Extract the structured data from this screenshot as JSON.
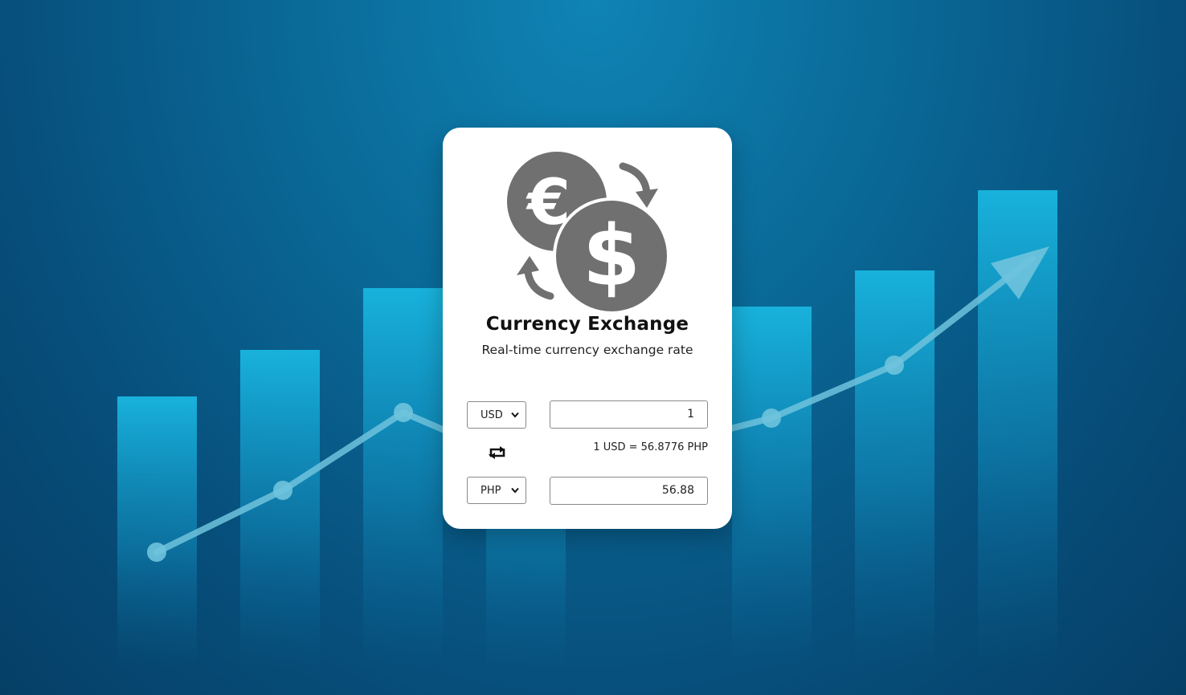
{
  "app": {
    "title": "Currency Exchange",
    "subtitle": "Real-time currency exchange rate"
  },
  "from": {
    "currency": "USD",
    "amount": "1"
  },
  "to": {
    "currency": "PHP",
    "amount": "56.88"
  },
  "rate_text": "1 USD = 56.8776 PHP",
  "icons": {
    "logo": "currency-exchange-icon",
    "swap": "swap-icon",
    "dropdown": "chevron-down-icon"
  },
  "colors": {
    "background": "#0a6a98",
    "bar": "#17afd8",
    "card": "#ffffff",
    "icon": "#707070"
  }
}
